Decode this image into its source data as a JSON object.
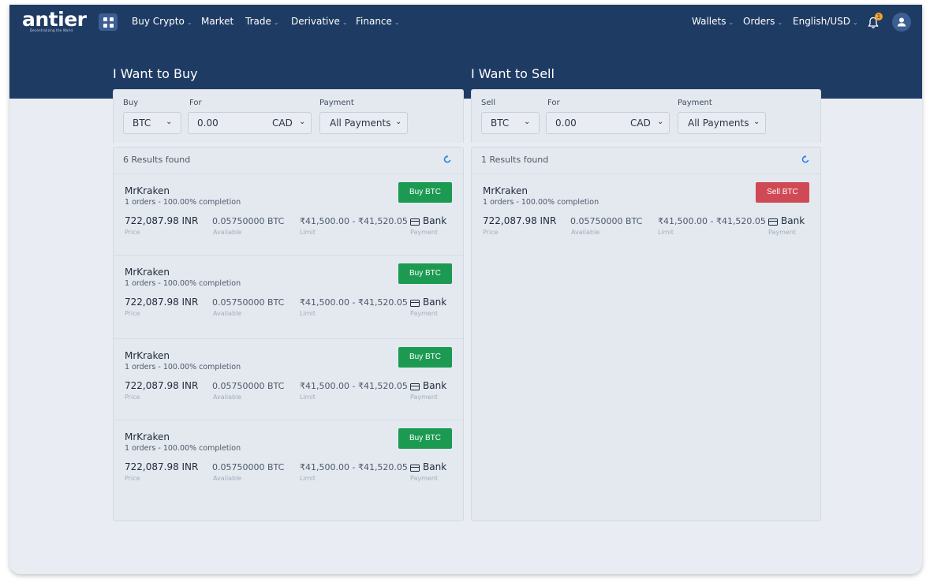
{
  "brand": {
    "logo_word": "antier",
    "logo_tagline": "Decentralizing the World"
  },
  "nav": {
    "left": [
      {
        "label": "Buy Crypto",
        "dropdown": true
      },
      {
        "label": "Market",
        "dropdown": false
      },
      {
        "label": "Trade",
        "dropdown": true
      },
      {
        "label": "Derivative",
        "dropdown": true
      },
      {
        "label": "Finance",
        "dropdown": true
      }
    ],
    "right": [
      {
        "label": "Wallets",
        "dropdown": true
      },
      {
        "label": "Orders",
        "dropdown": true
      },
      {
        "label": "English/USD",
        "dropdown": true
      }
    ],
    "notification_count": "1"
  },
  "buy_panel": {
    "title": "I Want to Buy",
    "filters": {
      "coin_label": "Buy",
      "coin_value": "BTC",
      "amount_label": "For",
      "amount_value": "0.00",
      "currency_value": "CAD",
      "payment_label": "Payment",
      "payment_value": "All Payments"
    },
    "results_text": "6 Results found",
    "rows": [
      {
        "merchant": "MrKraken",
        "orders": "1 orders",
        "completion": "100.00% completion",
        "action": "Buy BTC",
        "price": "722,087.98 INR",
        "price_label": "Price",
        "available": "0.05750000 BTC",
        "available_label": "Available",
        "limit": "₹41,500.00 - ₹41,520.05",
        "limit_label": "Limit",
        "payment": "Bank",
        "payment_label": "Payment"
      },
      {
        "merchant": "MrKraken",
        "orders": "1 orders",
        "completion": "100.00% completion",
        "action": "Buy BTC",
        "price": "722,087.98 INR",
        "price_label": "Price",
        "available": "0.05750000 BTC",
        "available_label": "Available",
        "limit": "₹41,500.00 - ₹41,520.05",
        "limit_label": "Limit",
        "payment": "Bank",
        "payment_label": "Payment"
      },
      {
        "merchant": "MrKraken",
        "orders": "1 orders",
        "completion": "100.00% completion",
        "action": "Buy BTC",
        "price": "722,087.98 INR",
        "price_label": "Price",
        "available": "0.05750000 BTC",
        "available_label": "Available",
        "limit": "₹41,500.00 - ₹41,520.05",
        "limit_label": "Limit",
        "payment": "Bank",
        "payment_label": "Payment"
      },
      {
        "merchant": "MrKraken",
        "orders": "1 orders",
        "completion": "100.00% completion",
        "action": "Buy BTC",
        "price": "722,087.98 INR",
        "price_label": "Price",
        "available": "0.05750000 BTC",
        "available_label": "Available",
        "limit": "₹41,500.00 - ₹41,520.05",
        "limit_label": "Limit",
        "payment": "Bank",
        "payment_label": "Payment"
      }
    ]
  },
  "sell_panel": {
    "title": "I Want to Sell",
    "filters": {
      "coin_label": "Sell",
      "coin_value": "BTC",
      "amount_label": "For",
      "amount_value": "0.00",
      "currency_value": "CAD",
      "payment_label": "Payment",
      "payment_value": "All Payments"
    },
    "results_text": "1 Results found",
    "rows": [
      {
        "merchant": "MrKraken",
        "orders": "1 orders",
        "completion": "100.00% completion",
        "action": "Sell BTC",
        "price": "722,087.98 INR",
        "price_label": "Price",
        "available": "0.05750000 BTC",
        "available_label": "Available",
        "limit": "₹41,500.00 - ₹41,520.05",
        "limit_label": "Limit",
        "payment": "Bank",
        "payment_label": "Payment"
      }
    ]
  },
  "colors": {
    "header_bg": "#1e3b63",
    "page_bg": "#e9edf3",
    "buy_button": "#1c9a52",
    "sell_button": "#d04a55",
    "refresh_icon": "#2b7de9",
    "notification_badge": "#f3a424"
  },
  "icons": {
    "apps": "grid-icon",
    "notifications": "bell-icon",
    "profile": "user-icon",
    "refresh": "refresh-icon",
    "payment": "card-icon",
    "dropdown": "chevron-down-icon"
  }
}
